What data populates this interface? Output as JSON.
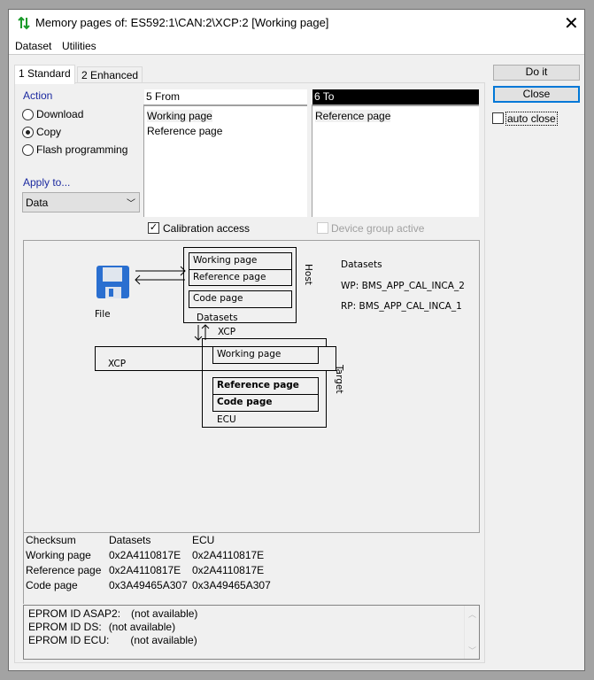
{
  "window": {
    "title": "Memory pages of: ES592:1\\CAN:2\\XCP:2 [Working page]",
    "icon": "memory-pages-icon",
    "close_icon": "close-icon"
  },
  "menu": [
    "Dataset",
    "Utilities"
  ],
  "tabs": [
    {
      "label": "1 Standard",
      "active": true
    },
    {
      "label": "2 Enhanced",
      "active": false
    }
  ],
  "buttons": {
    "do_it": "Do it",
    "close": "Close",
    "auto_close": "auto close",
    "auto_close_checked": false
  },
  "action": {
    "label": "Action",
    "options": [
      "Download",
      "Copy",
      "Flash programming"
    ],
    "selected": "Copy"
  },
  "apply_to": {
    "label": "Apply to...",
    "value": "Data"
  },
  "from": {
    "header": "5 From",
    "items": [
      "Working page",
      "Reference page"
    ],
    "selected": "Working page"
  },
  "to": {
    "header": "6 To",
    "items": [
      "Reference page"
    ],
    "selected": "Reference page"
  },
  "calibration_access": {
    "label": "Calibration access",
    "checked": true
  },
  "device_group_active": {
    "label": "Device group active",
    "checked": false,
    "enabled": false
  },
  "diagram": {
    "file_label": "File",
    "host_label": "Host",
    "host_pages": [
      "Working page",
      "Reference page",
      "Code page"
    ],
    "host_footer": "Datasets",
    "xcp_arrow_label": "XCP",
    "xcp_label": "XCP",
    "target_label": "Target",
    "target_working": "Working page",
    "target_pages": [
      "Reference page",
      "Code page"
    ],
    "ecu_label": "ECU",
    "datasets_title": "Datasets",
    "wp": "WP: BMS_APP_CAL_INCA_2",
    "rp": "RP: BMS_APP_CAL_INCA_1"
  },
  "checksum": {
    "headers": [
      "Checksum",
      "Datasets",
      "ECU"
    ],
    "rows": [
      [
        "Working page",
        "0x2A4110817E",
        "0x2A4110817E"
      ],
      [
        "Reference page",
        "0x2A4110817E",
        "0x2A4110817E"
      ],
      [
        "Code page",
        "0x3A49465A307",
        "0x3A49465A307"
      ]
    ]
  },
  "eprom": [
    {
      "label": "EPROM ID ASAP2:",
      "value": "(not available)"
    },
    {
      "label": "EPROM ID DS:",
      "value": "(not available)"
    },
    {
      "label": "EPROM ID ECU:",
      "value": "(not available)"
    }
  ]
}
